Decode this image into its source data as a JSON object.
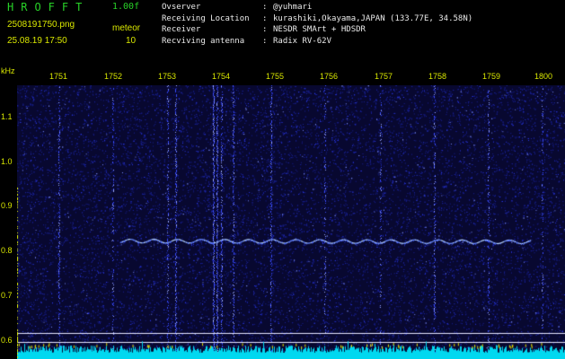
{
  "header": {
    "logo": "HROFFT",
    "version": "1.00f",
    "filename": "2508191750.png",
    "mode": "meteor",
    "timestamp": "25.08.19 17:50",
    "count": "10"
  },
  "station": [
    {
      "label": "Ovserver",
      "value": "@yuhmari"
    },
    {
      "label": "Receiving Location",
      "value": "kurashiki,Okayama,JAPAN (133.77E, 34.58N)"
    },
    {
      "label": "Receiver",
      "value": "NESDR SMArt + HDSDR"
    },
    {
      "label": "Recviving antenna",
      "value": "Radix RV-62V"
    }
  ],
  "y_axis_unit": "kHz",
  "time_ticks": [
    "1751",
    "1752",
    "1753",
    "1754",
    "1755",
    "1756",
    "1757",
    "1758",
    "1759",
    "1800"
  ],
  "freq_ticks": [
    "1.1",
    "1.0",
    "0.9",
    "0.8",
    "0.7",
    "0.6"
  ],
  "colors": {
    "background": "#000000",
    "waterfall_base": "#0a0a3a",
    "noise_blue": "#3040ff",
    "echo": "#a0c8ff",
    "signal_cyan": "#00e6ff",
    "label_yellow": "#d8e600",
    "logo_green": "#28d228"
  }
}
